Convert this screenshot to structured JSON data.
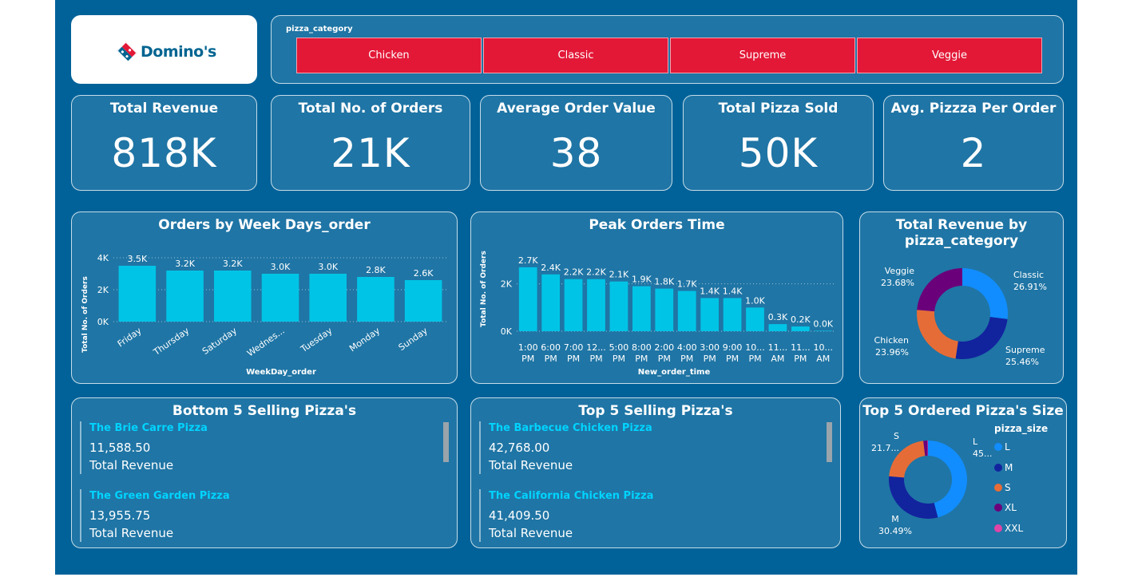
{
  "brand": {
    "name": "Domino's"
  },
  "slicer": {
    "label": "pizza_category",
    "options": [
      "Chicken",
      "Classic",
      "Supreme",
      "Veggie"
    ],
    "color": "#e31837"
  },
  "kpis": [
    {
      "title": "Total Revenue",
      "value": "818K"
    },
    {
      "title": "Total No. of Orders",
      "value": "21K"
    },
    {
      "title": "Average Order Value",
      "value": "38"
    },
    {
      "title": "Total Pizza Sold",
      "value": "50K"
    },
    {
      "title": "Avg. Pizzza Per Order",
      "value": "2"
    }
  ],
  "chart_data": [
    {
      "type": "bar",
      "title": "Orders by Week Days_order",
      "xlabel": "WeekDay_order",
      "ylabel": "Total No. of Orders",
      "categories": [
        "Friday",
        "Thursday",
        "Saturday",
        "Wednes...",
        "Tuesday",
        "Monday",
        "Sunday"
      ],
      "values": [
        3500,
        3200,
        3200,
        3000,
        3000,
        2800,
        2600
      ],
      "data_labels": [
        "3.5K",
        "3.2K",
        "3.2K",
        "3.0K",
        "3.0K",
        "2.8K",
        "2.6K"
      ],
      "yticks": [
        "0K",
        "2K",
        "4K"
      ],
      "ylim": [
        0,
        4200
      ],
      "color": "#00c4e6",
      "grid": true
    },
    {
      "type": "bar",
      "title": "Peak Orders Time",
      "xlabel": "New_order_time",
      "ylabel": "Total No. of Orders",
      "categories": [
        [
          "1:00",
          "PM"
        ],
        [
          "6:00",
          "PM"
        ],
        [
          "7:00",
          "PM"
        ],
        [
          "12...",
          "PM"
        ],
        [
          "5:00",
          "PM"
        ],
        [
          "8:00",
          "PM"
        ],
        [
          "2:00",
          "PM"
        ],
        [
          "4:00",
          "PM"
        ],
        [
          "3:00",
          "PM"
        ],
        [
          "9:00",
          "PM"
        ],
        [
          "10...",
          "PM"
        ],
        [
          "11...",
          "AM"
        ],
        [
          "11...",
          "PM"
        ],
        [
          "10...",
          "AM"
        ]
      ],
      "values": [
        2700,
        2400,
        2200,
        2200,
        2100,
        1900,
        1800,
        1700,
        1400,
        1400,
        1000,
        300,
        200,
        20
      ],
      "data_labels": [
        "2.7K",
        "2.4K",
        "2.2K",
        "2.2K",
        "2.1K",
        "1.9K",
        "1.8K",
        "1.7K",
        "1.4K",
        "1.4K",
        "1.0K",
        "0.3K",
        "0.2K",
        "0.0K"
      ],
      "yticks": [
        "0K",
        "2K"
      ],
      "ylim": [
        0,
        3000
      ],
      "color": "#00c4e6",
      "grid": true
    },
    {
      "type": "pie",
      "title": "Total Revenue by pizza_category",
      "title_lines": [
        "Total Revenue by",
        "pizza_category"
      ],
      "labels": [
        "Classic",
        "Supreme",
        "Chicken",
        "Veggie"
      ],
      "values": [
        26.91,
        25.46,
        23.96,
        23.68
      ],
      "value_labels": [
        "26.91%",
        "25.46%",
        "23.96%",
        "23.68%"
      ],
      "colors": [
        "#118dff",
        "#12239e",
        "#e66c37",
        "#6b007b"
      ]
    },
    {
      "type": "pie",
      "title": "Top 5 Ordered Pizza's Size",
      "legend_title": "pizza_size",
      "legend_position": "right",
      "labels": [
        "L",
        "M",
        "S",
        "XL",
        "XXL"
      ],
      "values": [
        45.9,
        30.49,
        21.7,
        1.7,
        0.2
      ],
      "value_labels": [
        "45...",
        "30.49%",
        "21.7...",
        "",
        ""
      ],
      "colors": [
        "#118dff",
        "#12239e",
        "#e66c37",
        "#6b007b",
        "#e044a7"
      ]
    }
  ],
  "bottom5": {
    "title": "Bottom 5 Selling Pizza's",
    "items": [
      {
        "name": "The Brie Carre Pizza",
        "value": "11,588.50",
        "label": "Total Revenue"
      },
      {
        "name": "The Green Garden Pizza",
        "value": "13,955.75",
        "label": "Total Revenue"
      }
    ]
  },
  "top5": {
    "title": "Top 5 Selling Pizza's",
    "items": [
      {
        "name": "The Barbecue Chicken Pizza",
        "value": "42,768.00",
        "label": "Total Revenue"
      },
      {
        "name": "The California Chicken Pizza",
        "value": "41,409.50",
        "label": "Total Revenue"
      }
    ]
  }
}
